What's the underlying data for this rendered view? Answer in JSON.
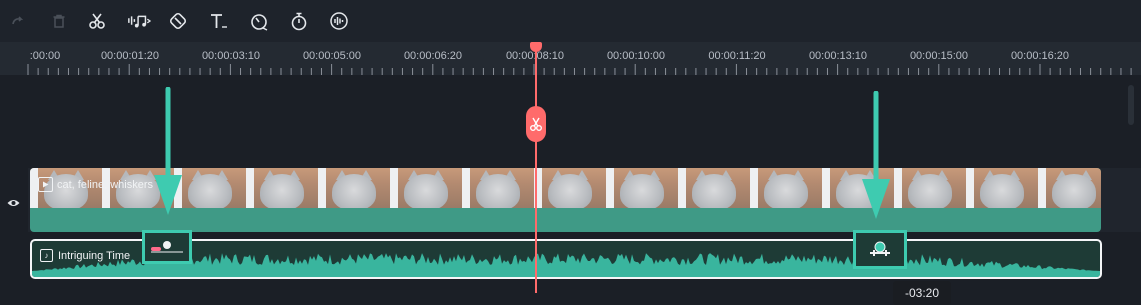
{
  "toolbar": {
    "icons": [
      "redo-icon",
      "delete-icon",
      "cut-icon",
      "audio-icon",
      "mark-icon",
      "text-icon",
      "speed-icon",
      "timer-icon",
      "voice-icon"
    ]
  },
  "ruler": {
    "labels": [
      ":00:00",
      "00:00:01:20",
      "00:00:03:10",
      "00:00:05:00",
      "00:00:06:20",
      "00:00:08:10",
      "00:00:10:00",
      "00:00:11:20",
      "00:00:13:10",
      "00:00:15:00",
      "00:00:16:20"
    ]
  },
  "video_clip": {
    "label": "cat, feline, whiskers"
  },
  "audio_clip": {
    "label": "Intriguing Time"
  },
  "tooltip": {
    "text": "-03:20"
  },
  "colors": {
    "accent": "#3ecbb0",
    "playhead": "#ff6b6b",
    "clip": "#3f9a86"
  }
}
